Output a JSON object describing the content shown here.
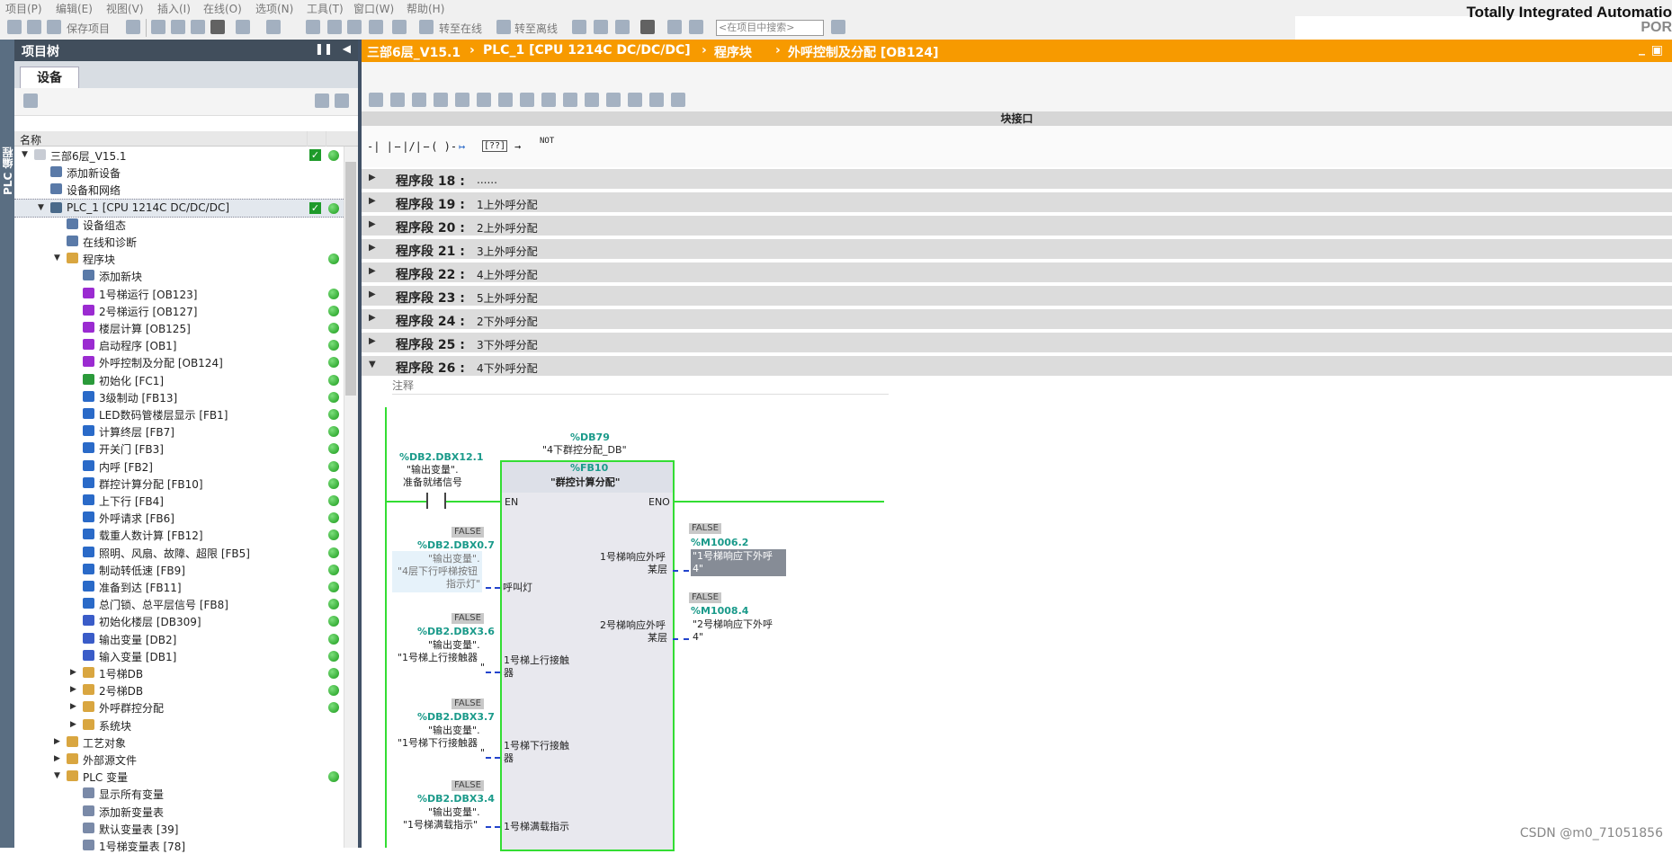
{
  "menu": [
    "项目(P)",
    "编辑(E)",
    "视图(V)",
    "插入(I)",
    "在线(O)",
    "选项(N)",
    "工具(T)",
    "窗口(W)",
    "帮助(H)"
  ],
  "brand": {
    "line1": "Totally Integrated Automatio",
    "line2": "POR"
  },
  "toolbar": {
    "save_project": "保存项目",
    "go_online": "转至在线",
    "go_offline": "转至离线",
    "search_placeholder": "<在项目中搜索>"
  },
  "left_rail": {
    "label": "PLC 编程"
  },
  "project_tree": {
    "title": "项目树",
    "tab": "设备",
    "column_header": "名称",
    "items": [
      {
        "label": "三部6层_V15.1",
        "level": 0,
        "arrow": "down",
        "icon": "project-icon",
        "check": true,
        "dot": true
      },
      {
        "label": "添加新设备",
        "level": 1,
        "arrow": "",
        "icon": "add-device-icon",
        "check": false,
        "dot": false
      },
      {
        "label": "设备和网络",
        "level": 1,
        "arrow": "",
        "icon": "network-icon",
        "check": false,
        "dot": false
      },
      {
        "label": "PLC_1 [CPU 1214C DC/DC/DC]",
        "level": 1,
        "arrow": "down",
        "icon": "plc-icon",
        "check": true,
        "dot": true,
        "selected": true
      },
      {
        "label": "设备组态",
        "level": 2,
        "arrow": "",
        "icon": "device-config-icon",
        "check": false,
        "dot": false
      },
      {
        "label": "在线和诊断",
        "level": 2,
        "arrow": "",
        "icon": "diagnostics-icon",
        "check": false,
        "dot": false
      },
      {
        "label": "程序块",
        "level": 2,
        "arrow": "down",
        "icon": "folder-icon",
        "check": false,
        "dot": true
      },
      {
        "label": "添加新块",
        "level": 3,
        "arrow": "",
        "icon": "add-block-icon",
        "check": false,
        "dot": false
      },
      {
        "label": "1号梯运行 [OB123]",
        "level": 3,
        "arrow": "",
        "icon": "ob-icon",
        "check": false,
        "dot": true
      },
      {
        "label": "2号梯运行 [OB127]",
        "level": 3,
        "arrow": "",
        "icon": "ob-icon",
        "check": false,
        "dot": true
      },
      {
        "label": "楼层计算 [OB125]",
        "level": 3,
        "arrow": "",
        "icon": "ob-icon",
        "check": false,
        "dot": true
      },
      {
        "label": "启动程序 [OB1]",
        "level": 3,
        "arrow": "",
        "icon": "ob-icon",
        "check": false,
        "dot": true
      },
      {
        "label": "外呼控制及分配 [OB124]",
        "level": 3,
        "arrow": "",
        "icon": "ob-icon",
        "check": false,
        "dot": true
      },
      {
        "label": "初始化 [FC1]",
        "level": 3,
        "arrow": "",
        "icon": "fc-icon",
        "check": false,
        "dot": true
      },
      {
        "label": "3级制动 [FB13]",
        "level": 3,
        "arrow": "",
        "icon": "fb-icon",
        "check": false,
        "dot": true
      },
      {
        "label": "LED数码管楼层显示 [FB1]",
        "level": 3,
        "arrow": "",
        "icon": "fb-icon",
        "check": false,
        "dot": true
      },
      {
        "label": "计算终层 [FB7]",
        "level": 3,
        "arrow": "",
        "icon": "fb-icon",
        "check": false,
        "dot": true
      },
      {
        "label": "开关门 [FB3]",
        "level": 3,
        "arrow": "",
        "icon": "fb-icon",
        "check": false,
        "dot": true
      },
      {
        "label": "内呼 [FB2]",
        "level": 3,
        "arrow": "",
        "icon": "fb-icon",
        "check": false,
        "dot": true
      },
      {
        "label": "群控计算分配 [FB10]",
        "level": 3,
        "arrow": "",
        "icon": "fb-icon",
        "check": false,
        "dot": true
      },
      {
        "label": "上下行 [FB4]",
        "level": 3,
        "arrow": "",
        "icon": "fb-icon",
        "check": false,
        "dot": true
      },
      {
        "label": "外呼请求 [FB6]",
        "level": 3,
        "arrow": "",
        "icon": "fb-icon",
        "check": false,
        "dot": true
      },
      {
        "label": "载重人数计算 [FB12]",
        "level": 3,
        "arrow": "",
        "icon": "fb-icon",
        "check": false,
        "dot": true
      },
      {
        "label": "照明、风扇、故障、超限 [FB5]",
        "level": 3,
        "arrow": "",
        "icon": "fb-icon",
        "check": false,
        "dot": true
      },
      {
        "label": "制动转低速 [FB9]",
        "level": 3,
        "arrow": "",
        "icon": "fb-icon",
        "check": false,
        "dot": true
      },
      {
        "label": "准备到达 [FB11]",
        "level": 3,
        "arrow": "",
        "icon": "fb-icon",
        "check": false,
        "dot": true
      },
      {
        "label": "总门锁、总平层信号 [FB8]",
        "level": 3,
        "arrow": "",
        "icon": "fb-icon",
        "check": false,
        "dot": true
      },
      {
        "label": "初始化楼层 [DB309]",
        "level": 3,
        "arrow": "",
        "icon": "db-icon",
        "check": false,
        "dot": true
      },
      {
        "label": "输出变量 [DB2]",
        "level": 3,
        "arrow": "",
        "icon": "db-icon",
        "check": false,
        "dot": true
      },
      {
        "label": "输入变量 [DB1]",
        "level": 3,
        "arrow": "",
        "icon": "db-icon",
        "check": false,
        "dot": true
      },
      {
        "label": "1号梯DB",
        "level": 3,
        "arrow": "right",
        "icon": "folder-icon",
        "check": false,
        "dot": true
      },
      {
        "label": "2号梯DB",
        "level": 3,
        "arrow": "right",
        "icon": "folder-icon",
        "check": false,
        "dot": true
      },
      {
        "label": "外呼群控分配",
        "level": 3,
        "arrow": "right",
        "icon": "folder-icon",
        "check": false,
        "dot": true
      },
      {
        "label": "系统块",
        "level": 3,
        "arrow": "right",
        "icon": "folder-icon",
        "check": false,
        "dot": false
      },
      {
        "label": "工艺对象",
        "level": 2,
        "arrow": "right",
        "icon": "folder-icon",
        "check": false,
        "dot": false
      },
      {
        "label": "外部源文件",
        "level": 2,
        "arrow": "right",
        "icon": "folder-icon",
        "check": false,
        "dot": false
      },
      {
        "label": "PLC 变量",
        "level": 2,
        "arrow": "down",
        "icon": "folder-icon",
        "check": false,
        "dot": true
      },
      {
        "label": "显示所有变量",
        "level": 3,
        "arrow": "",
        "icon": "tag-table-icon",
        "check": false,
        "dot": false
      },
      {
        "label": "添加新变量表",
        "level": 3,
        "arrow": "",
        "icon": "add-tag-icon",
        "check": false,
        "dot": false
      },
      {
        "label": "默认变量表 [39]",
        "level": 3,
        "arrow": "",
        "icon": "tag-table-icon",
        "check": false,
        "dot": false
      },
      {
        "label": "1号梯变量表 [78]",
        "level": 3,
        "arrow": "",
        "icon": "tag-table-icon",
        "check": false,
        "dot": false
      }
    ]
  },
  "editor": {
    "breadcrumb": [
      "三部6层_V15.1",
      "PLC_1 [CPU 1214C DC/DC/DC]",
      "程序块",
      "外呼控制及分配 [OB124]"
    ],
    "block_interface": "块接口",
    "ladder_tools": [
      "-| |-",
      "-|/|-",
      "-( )-",
      "↦",
      "[??]",
      "→",
      "NOT"
    ],
    "networks": [
      {
        "label": "程序段 18 :",
        "comment": "......",
        "expanded": false
      },
      {
        "label": "程序段 19 :",
        "comment": "1上外呼分配",
        "expanded": false
      },
      {
        "label": "程序段 20 :",
        "comment": "2上外呼分配",
        "expanded": false
      },
      {
        "label": "程序段 21 :",
        "comment": "3上外呼分配",
        "expanded": false
      },
      {
        "label": "程序段 22 :",
        "comment": "4上外呼分配",
        "expanded": false
      },
      {
        "label": "程序段 23 :",
        "comment": "5上外呼分配",
        "expanded": false
      },
      {
        "label": "程序段 24 :",
        "comment": "2下外呼分配",
        "expanded": false
      },
      {
        "label": "程序段 25 :",
        "comment": "3下外呼分配",
        "expanded": false
      },
      {
        "label": "程序段 26 :",
        "comment": "4下外呼分配",
        "expanded": true
      }
    ],
    "net_comment": "注释",
    "ladder": {
      "contact_addr": "%DB2.DBX12.1",
      "contact_name": "\"输出变量\".",
      "contact_name2": "准备就绪信号",
      "instance_db": "%DB79",
      "instance_name": "\"4下群控分配_DB\"",
      "fb_number": "%FB10",
      "fb_name": "\"群控计算分配\"",
      "en": "EN",
      "eno": "ENO",
      "inputs": [
        {
          "false": "FALSE",
          "addr": "%DB2.DBX0.7",
          "l1": "\"输出变量\".",
          "l2": "\"4层下行呼梯按钮",
          "l3": "指示灯\"",
          "pin": "呼叫灯"
        },
        {
          "false": "FALSE",
          "addr": "%DB2.DBX3.6",
          "l1": "\"输出变量\".",
          "l2": "\"1号梯上行接触器",
          "l3": "\"",
          "pin": "1号梯上行接触",
          "pin2": "器"
        },
        {
          "false": "FALSE",
          "addr": "%DB2.DBX3.7",
          "l1": "\"输出变量\".",
          "l2": "\"1号梯下行接触器",
          "l3": "\"",
          "pin": "1号梯下行接触",
          "pin2": "器"
        },
        {
          "false": "FALSE",
          "addr": "%DB2.DBX3.4",
          "l1": "\"输出变量\".",
          "l2": "\"1号梯满载指示\"",
          "l3": "",
          "pin": "1号梯满载指示"
        }
      ],
      "outputs": [
        {
          "pin": "1号梯响应外呼",
          "pin2": "某层",
          "false": "FALSE",
          "addr": "%M1006.2",
          "l1": "\"1号梯响应下外呼",
          "l2": "4\""
        },
        {
          "pin": "2号梯响应外呼",
          "pin2": "某层",
          "false": "FALSE",
          "addr": "%M1008.4",
          "l1": "\"2号梯响应下外呼",
          "l2": "4\""
        }
      ]
    }
  },
  "watermark": "CSDN @m0_71051856"
}
